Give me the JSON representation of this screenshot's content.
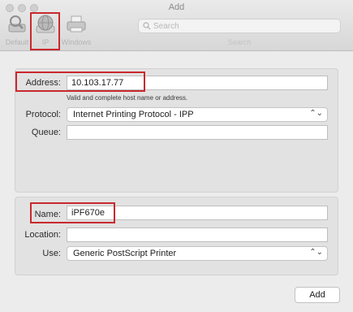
{
  "window": {
    "title": "Add"
  },
  "toolbar": {
    "items": [
      {
        "label": "Default",
        "icon": "default-printer-icon"
      },
      {
        "label": "IP",
        "icon": "globe-icon"
      },
      {
        "label": "Windows",
        "icon": "windows-printer-icon"
      }
    ],
    "search_placeholder": "Search",
    "search_label": "Search"
  },
  "address_panel": {
    "address_label": "Address:",
    "address_value": "10.103.17.77",
    "address_hint": "Valid and complete host name or address.",
    "protocol_label": "Protocol:",
    "protocol_value": "Internet Printing Protocol - IPP",
    "queue_label": "Queue:",
    "queue_value": ""
  },
  "details_panel": {
    "name_label": "Name:",
    "name_value": "iPF670e",
    "location_label": "Location:",
    "location_value": "",
    "use_label": "Use:",
    "use_value": "Generic PostScript Printer"
  },
  "footer": {
    "add_label": "Add"
  },
  "colors": {
    "highlight": "#c9292e",
    "panel": "#e2e2e2",
    "window": "#ececec"
  }
}
